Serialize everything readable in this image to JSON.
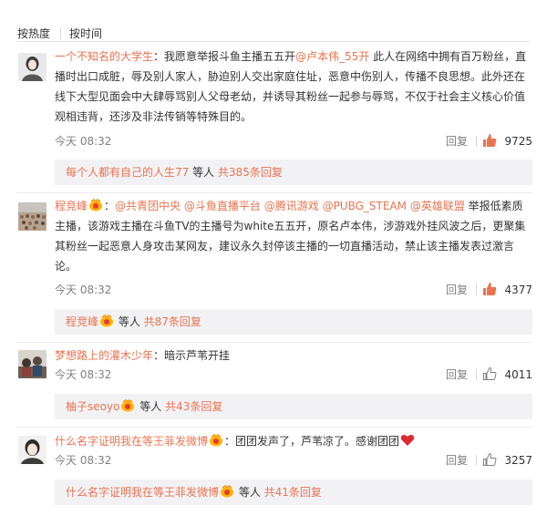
{
  "sort": {
    "hot_label": "按热度",
    "time_label": "按时间"
  },
  "comments": [
    {
      "user": "一个不知名的大学生",
      "colon": "：",
      "text_a": "我愿意举报斗鱼主播五五开",
      "mention_1": "@卢本伟_55开",
      "text_b": " 此人在网络中拥有百万粉丝，直播时出口成脏，辱及别人家人，胁迫别人交出家庭住址，恶意中伤别人，传播不良思想。此外还在线下大型见面会中大肆辱骂别人父母老幼，并诱导其粉丝一起参与辱骂，不仅于社会主义核心价值观相违背，还涉及非法传销等特殊目的。",
      "time": "今天 08:32",
      "reply_label": "回复",
      "likes": "9725",
      "liked": true,
      "sub_user": "每个人都有自己的人生77",
      "sub_text": " 等人 ",
      "sub_count": "共385条回复"
    },
    {
      "user": "程竞峰",
      "colon": "：",
      "mentions": [
        "@共青团中央",
        "@斗鱼直播平台",
        "@腾讯游戏",
        "@PUBG_STEAM",
        "@英雄联盟"
      ],
      "text_b": " 举报低素质主播，该游戏主播在斗鱼TV的主播号为white五五开，原名卢本伟，涉游戏外挂风波之后，更聚集其粉丝一起恶意人身攻击某网友，建议永久封停该主播的一切直播活动，禁止该主播发表过激言论。",
      "time": "今天 08:32",
      "reply_label": "回复",
      "likes": "4377",
      "liked": true,
      "sub_user": "程竞峰",
      "sub_text": " 等人 ",
      "sub_count": "共87条回复"
    },
    {
      "user": "梦想路上的灌木少年",
      "colon": "：",
      "text_b": "暗示芦苇开挂",
      "time": "今天 08:32",
      "reply_label": "回复",
      "likes": "4011",
      "liked": false,
      "sub_user": "柚子seoyo",
      "sub_text": " 等人 ",
      "sub_count": "共43条回复"
    },
    {
      "user": "什么名字证明我在等王菲发微博",
      "colon": "：",
      "text_b": "团团发声了，芦苇凉了。感谢团团",
      "time": "今天 08:32",
      "reply_label": "回复",
      "likes": "3257",
      "liked": false,
      "sub_user": "什么名字证明我在等王菲发微博",
      "sub_text": " 等人 ",
      "sub_count": "共41条回复"
    }
  ],
  "colors": {
    "link": "#eb7350",
    "meta": "#808080",
    "sub_bg": "#f2f2f5",
    "like_active": "#eb7350"
  }
}
